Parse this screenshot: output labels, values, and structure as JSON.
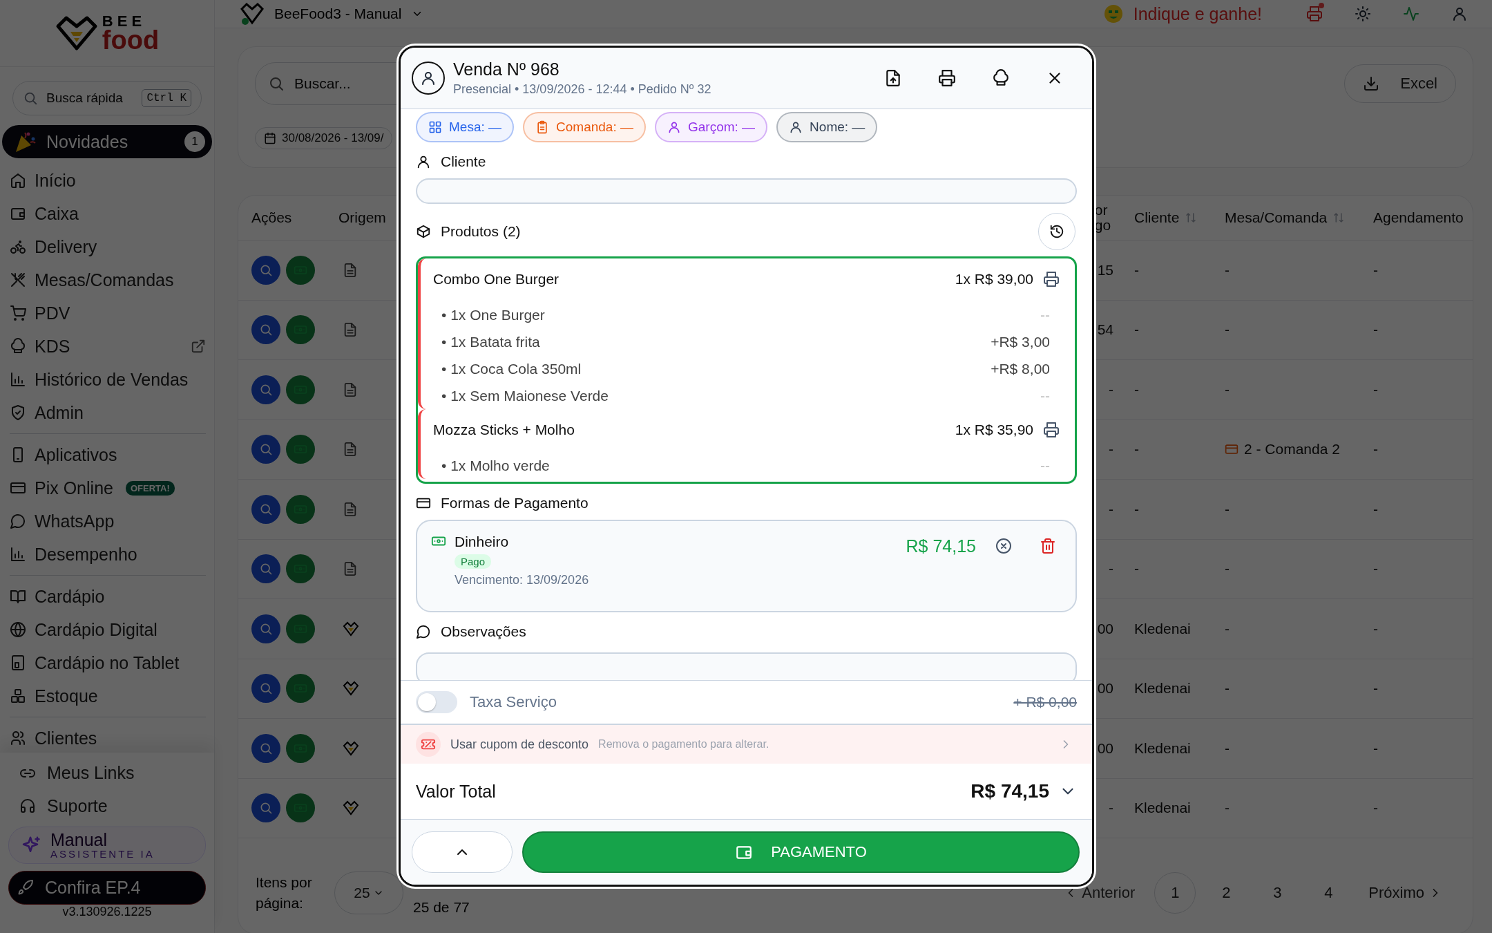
{
  "sidebar": {
    "logo": {
      "word_1": "BEE",
      "word_2": "food"
    },
    "search": {
      "placeholder": "Busca rápida",
      "shortcut": "Ctrl K"
    },
    "news": {
      "label": "Novidades",
      "count": "1"
    },
    "groups": [
      [
        {
          "kind": "home",
          "label": "Início",
          "external": false
        },
        {
          "kind": "wallet",
          "label": "Caixa",
          "external": false
        },
        {
          "kind": "bike",
          "label": "Delivery",
          "external": false
        },
        {
          "kind": "utensils",
          "label": "Mesas/Comandas",
          "external": false
        },
        {
          "kind": "cart",
          "label": "PDV",
          "external": false
        },
        {
          "kind": "chef",
          "label": "KDS",
          "external": true
        },
        {
          "kind": "chart",
          "label": "Histórico de Vendas",
          "external": false
        },
        {
          "kind": "shield",
          "label": "Admin",
          "external": false
        }
      ],
      [
        {
          "kind": "phone",
          "label": "Aplicativos",
          "external": false
        },
        {
          "kind": "card",
          "label": "Pix Online",
          "external": false,
          "tag": "OFERTA!"
        },
        {
          "kind": "chat",
          "label": "WhatsApp",
          "external": false
        },
        {
          "kind": "chart",
          "label": "Desempenho",
          "external": false
        }
      ],
      [
        {
          "kind": "book",
          "label": "Cardápio",
          "external": false
        },
        {
          "kind": "globe",
          "label": "Cardápio Digital",
          "external": false
        },
        {
          "kind": "tablet",
          "label": "Cardápio no Tablet",
          "external": false
        },
        {
          "kind": "boxes",
          "label": "Estoque",
          "external": false
        }
      ],
      [
        {
          "kind": "users",
          "label": "Clientes",
          "external": false
        }
      ]
    ],
    "footer_links": [
      {
        "kind": "link",
        "label": "Meus Links"
      },
      {
        "kind": "headset",
        "label": "Suporte"
      }
    ],
    "assistant": {
      "title": "Manual",
      "subtitle": "ASSISTENTE IA"
    },
    "cta": "Confira EP.4",
    "version": "v3.130926.1225"
  },
  "topbar": {
    "app_name": "BeeFood3 - Manual",
    "referral": "Indique e ganhe!"
  },
  "filters": {
    "search_placeholder": "Buscar...",
    "export_button": "Excel",
    "date_range": "30/08/2026 - 13/09/"
  },
  "table": {
    "columns": [
      {
        "label": "Ações",
        "sortable": false
      },
      {
        "label": "Origem",
        "sortable": false
      },
      {
        "label": "or go",
        "sortable": false
      },
      {
        "label": "Cliente",
        "sortable": true
      },
      {
        "label": "Mesa/Comanda",
        "sortable": true
      },
      {
        "label": "Agendamento",
        "sortable": false
      }
    ],
    "rows": [
      {
        "kind": "document",
        "column_3": "15",
        "cliente": "-",
        "mesa_comanda": "-",
        "comanda_icon": false,
        "agendamento": "-"
      },
      {
        "kind": "document",
        "column_3": "54",
        "cliente": "-",
        "mesa_comanda": "-",
        "comanda_icon": false,
        "agendamento": "-"
      },
      {
        "kind": "document",
        "column_3": "-",
        "cliente": "-",
        "mesa_comanda": "-",
        "comanda_icon": false,
        "agendamento": "-"
      },
      {
        "kind": "document",
        "column_3": "-",
        "cliente": "-",
        "mesa_comanda": "2 - Comanda 2",
        "comanda_icon": true,
        "agendamento": "-"
      },
      {
        "kind": "document",
        "column_3": "-",
        "cliente": "-",
        "mesa_comanda": "-",
        "comanda_icon": false,
        "agendamento": "-"
      },
      {
        "kind": "document",
        "column_3": "-",
        "cliente": "-",
        "mesa_comanda": "-",
        "comanda_icon": false,
        "agendamento": "-"
      },
      {
        "kind": "logo",
        "column_3": "00",
        "cliente": "Kledenai",
        "mesa_comanda": "-",
        "comanda_icon": false,
        "agendamento": "-"
      },
      {
        "kind": "logo",
        "column_3": "00",
        "cliente": "Kledenai",
        "mesa_comanda": "-",
        "comanda_icon": false,
        "agendamento": "-"
      },
      {
        "kind": "logo",
        "column_3": "00",
        "cliente": "Kledenai",
        "mesa_comanda": "-",
        "comanda_icon": false,
        "agendamento": "-"
      },
      {
        "kind": "logo",
        "column_3": "-",
        "cliente": "Kledenai",
        "mesa_comanda": "-",
        "comanda_icon": false,
        "agendamento": "-"
      }
    ]
  },
  "pagination": {
    "per_page_label": "Itens por página:",
    "per_page": "25",
    "range": "25 de 77",
    "prev": "Anterior",
    "next": "Próximo",
    "pages": [
      {
        "label": "1",
        "selected": true
      },
      {
        "label": "2",
        "selected": false
      },
      {
        "label": "3",
        "selected": false
      },
      {
        "label": "4",
        "selected": false
      }
    ]
  },
  "modal": {
    "title": "Venda Nº 968",
    "subtitle": "Presencial • 13/09/2026 - 12:44 • Pedido Nº 32",
    "chips": [
      {
        "kind": "grid",
        "label": "Mesa:",
        "value": "—",
        "color": "#2563eb"
      },
      {
        "kind": "clipboard",
        "label": "Comanda:",
        "value": "—",
        "color": "#ea580c"
      },
      {
        "kind": "user",
        "label": "Garçom:",
        "value": "—",
        "color": "#9333ea"
      },
      {
        "kind": "user",
        "label": "Nome:",
        "value": "—",
        "color": "#334155"
      }
    ],
    "client_label": "Cliente",
    "products_label": "Produtos (2)",
    "products": [
      {
        "name": "Combo One Burger",
        "price": "1x R$ 39,00",
        "options": [
          {
            "text": "• 1x One Burger",
            "price": "--"
          },
          {
            "text": "• 1x Batata frita",
            "price": "+R$ 3,00"
          },
          {
            "text": "• 1x Coca Cola 350ml",
            "price": "+R$ 8,00"
          },
          {
            "text": "• 1x Sem Maionese Verde",
            "price": "--"
          }
        ]
      },
      {
        "name": "Mozza Sticks + Molho",
        "price": "1x R$ 35,90",
        "options": [
          {
            "text": "• 1x Molho verde",
            "price": "--"
          }
        ]
      }
    ],
    "payments_label": "Formas de Pagamento",
    "payments": [
      {
        "method": "Dinheiro",
        "status": "Pago",
        "due": "Vencimento: 13/09/2026",
        "amount": "R$ 74,15"
      }
    ],
    "notes_label": "Observações",
    "service_fee": {
      "label": "Taxa Serviço",
      "on": false,
      "amount": "+ R$ 0,00"
    },
    "coupon": {
      "label": "Usar cupom de desconto",
      "hint": "Remova o pagamento para alterar."
    },
    "total": {
      "label": "Valor Total",
      "amount": "R$ 74,15"
    },
    "pay_button": "PAGAMENTO"
  }
}
